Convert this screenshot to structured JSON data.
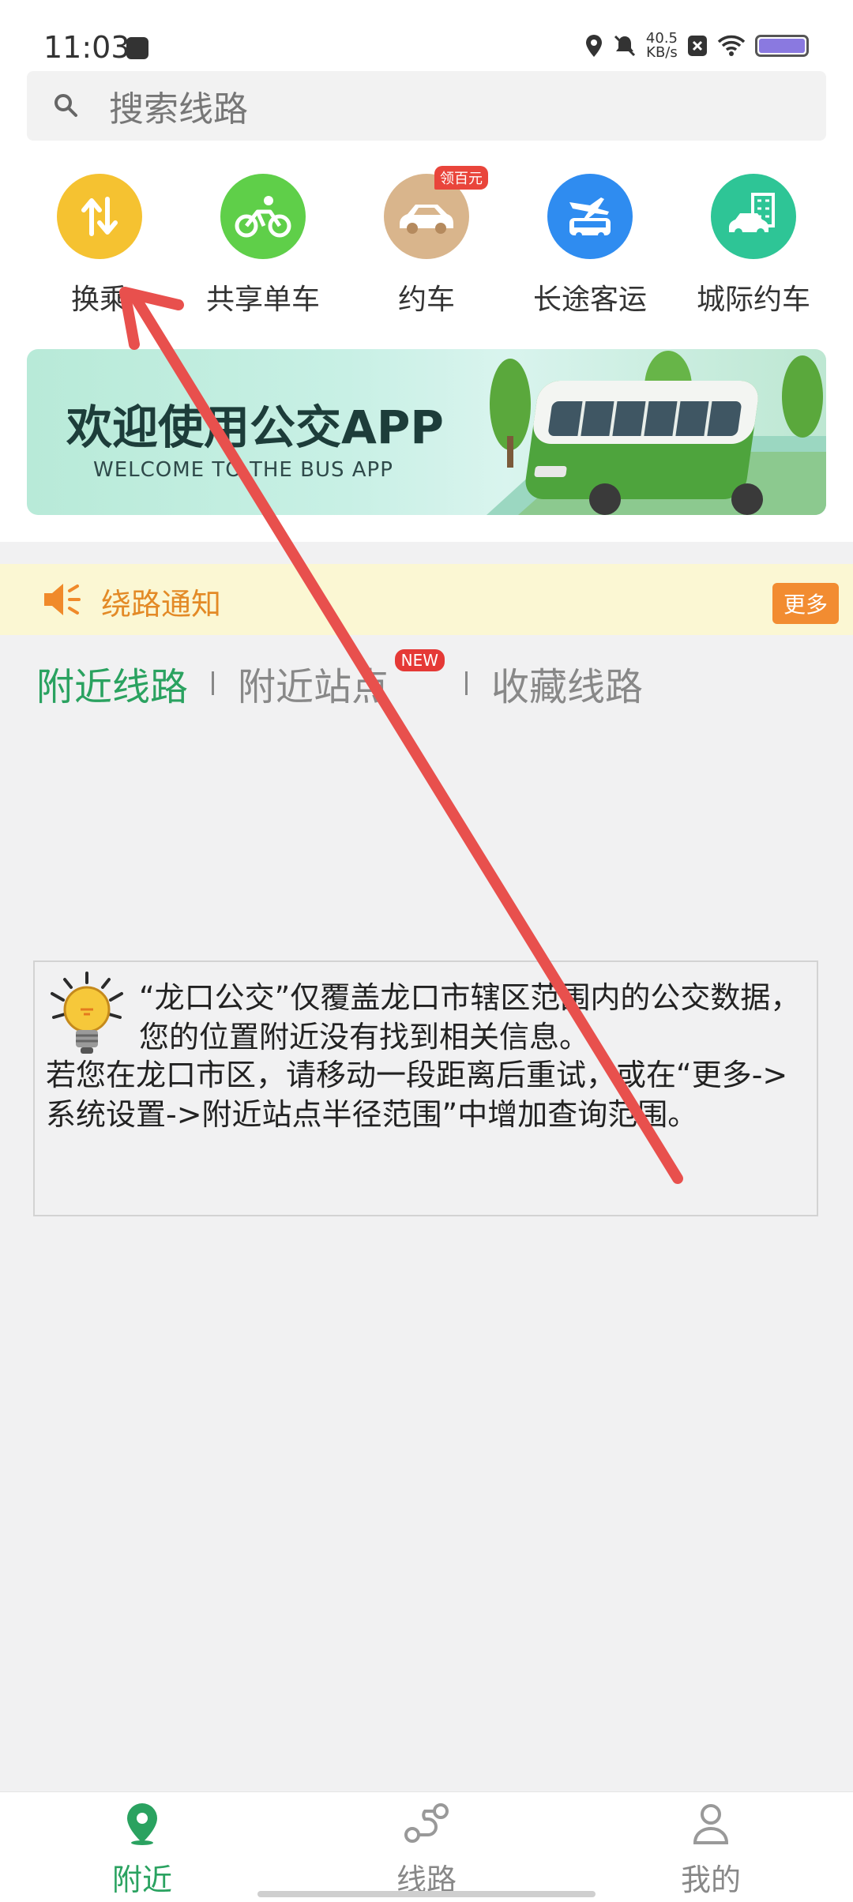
{
  "status": {
    "time": "11:03",
    "net_rate": "40.5",
    "net_unit": "KB/s"
  },
  "search": {
    "placeholder": "搜索线路"
  },
  "quick_entries": [
    {
      "label": "换乘",
      "icon": "transfer-icon",
      "color": "#f5c231"
    },
    {
      "label": "共享单车",
      "icon": "bike-icon",
      "color": "#5fcf49"
    },
    {
      "label": "约车",
      "icon": "car-icon",
      "color": "#d9b58c",
      "badge": "领百元"
    },
    {
      "label": "长途客运",
      "icon": "coach-plane-icon",
      "color": "#2f8cf0"
    },
    {
      "label": "城际约车",
      "icon": "intercity-icon",
      "color": "#2ec596"
    }
  ],
  "banner": {
    "title": "欢迎使用公交APP",
    "subtitle": "WELCOME TO THE BUS APP"
  },
  "notice": {
    "text": "绕路通知",
    "more": "更多"
  },
  "tabs": {
    "nearby_lines": "附近线路",
    "nearby_stops": "附近站点",
    "new_badge": "NEW",
    "favorite_lines": "收藏线路"
  },
  "info": {
    "p1": "“龙口公交”仅覆盖龙口市辖区范围内的公交数据，您的位置附近没有找到相关信息。",
    "p2": "若您在龙口市区，请移动一段距离后重试，或在“更多->系统设置->附近站点半径范围”中增加查询范围。"
  },
  "nav": {
    "nearby": "附近",
    "lines": "线路",
    "mine": "我的"
  },
  "colors": {
    "accent": "#2aa260",
    "annotation": "#e8504d"
  }
}
